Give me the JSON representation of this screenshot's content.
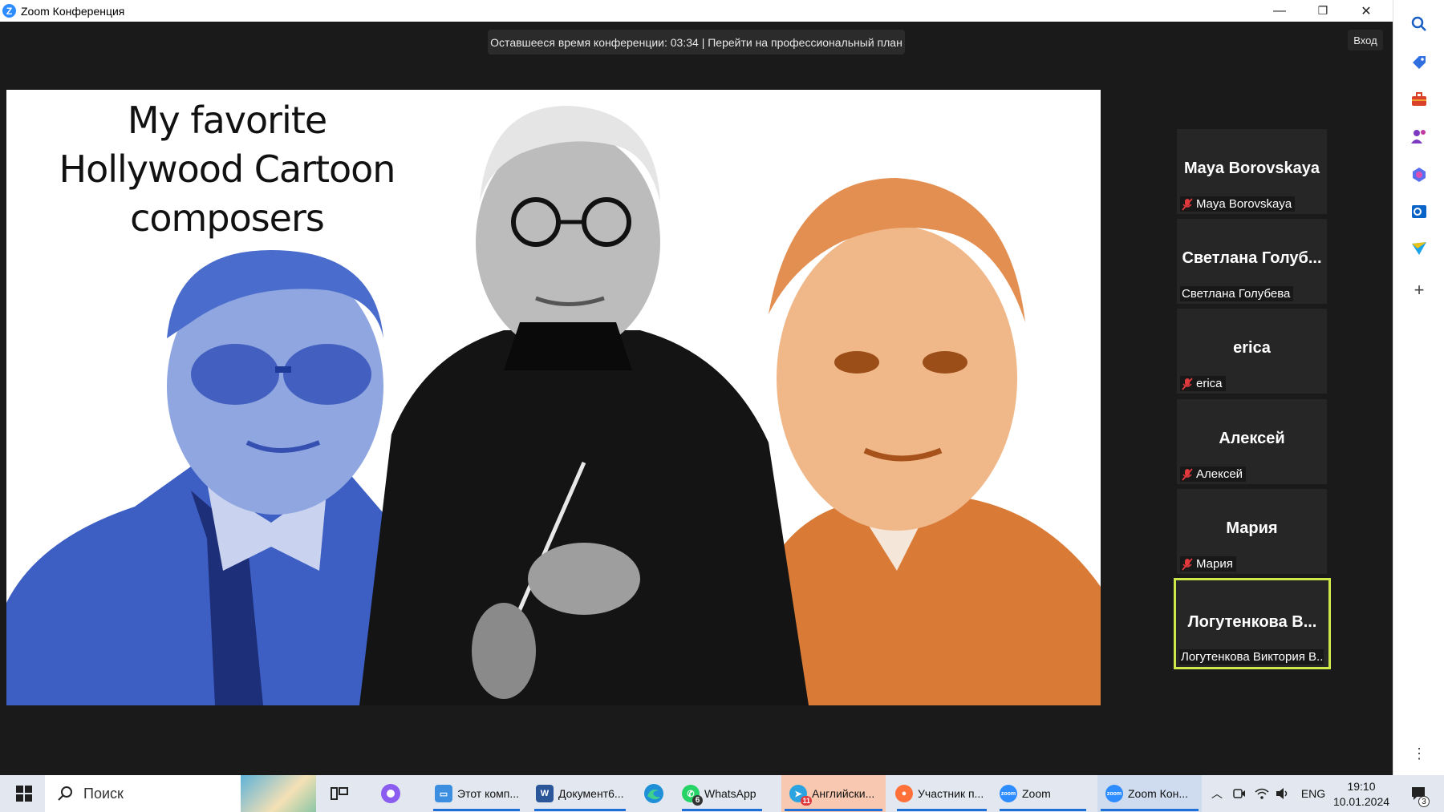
{
  "window": {
    "title": "Zoom Конференция",
    "minimize": "—",
    "maximize": "❐",
    "close": "✕"
  },
  "banner": {
    "text": "Оставшееся время конференции: 03:34 | Перейти на профессиональный план"
  },
  "login_label": "Вход",
  "slide": {
    "title_lines": [
      "My favorite",
      "Hollywood Cartoon",
      "composers"
    ]
  },
  "participants": [
    {
      "display": "Maya Borovskaya",
      "name": "Maya Borovskaya",
      "muted": true,
      "active": false
    },
    {
      "display": "Светлана Голуб...",
      "name": "Светлана Голубева",
      "muted": false,
      "active": false
    },
    {
      "display": "erica",
      "name": "erica",
      "muted": true,
      "active": false
    },
    {
      "display": "Алексей",
      "name": "Алексей",
      "muted": true,
      "active": false
    },
    {
      "display": "Мария",
      "name": "Мария",
      "muted": true,
      "active": false
    },
    {
      "display": "Логутенкова В...",
      "name": "Логутенкова Виктория В...",
      "muted": false,
      "active": true
    }
  ],
  "sidebar_icons": [
    "search-icon",
    "tag-icon",
    "briefcase-icon",
    "people-icon",
    "copilot-icon",
    "outlook-icon",
    "send-icon",
    "plus-icon",
    "more-icon"
  ],
  "taskbar": {
    "search_placeholder": "Поиск",
    "items": [
      {
        "label": "Этот комп...",
        "icon": "computer-icon"
      },
      {
        "label": "Документ6...",
        "icon": "word-icon"
      },
      {
        "label": "",
        "icon": "edge-icon"
      },
      {
        "label": "WhatsApp",
        "icon": "whatsapp-icon",
        "badge": "6"
      },
      {
        "label": "Английски...",
        "icon": "telegram-icon",
        "badge": "11"
      },
      {
        "label": "Участник п...",
        "icon": "firefox-icon"
      },
      {
        "label": "Zoom",
        "icon": "zoom-icon"
      },
      {
        "label": "Zoom Кон...",
        "icon": "zoom-icon"
      }
    ],
    "lang": "ENG",
    "time": "19:10",
    "date": "10.01.2024",
    "notif_count": "3"
  },
  "colors": {
    "active_border": "#cde84a",
    "accent_blue": "#2d8cff",
    "tile_bg": "#262626",
    "muted_icon": "#e0393e"
  }
}
